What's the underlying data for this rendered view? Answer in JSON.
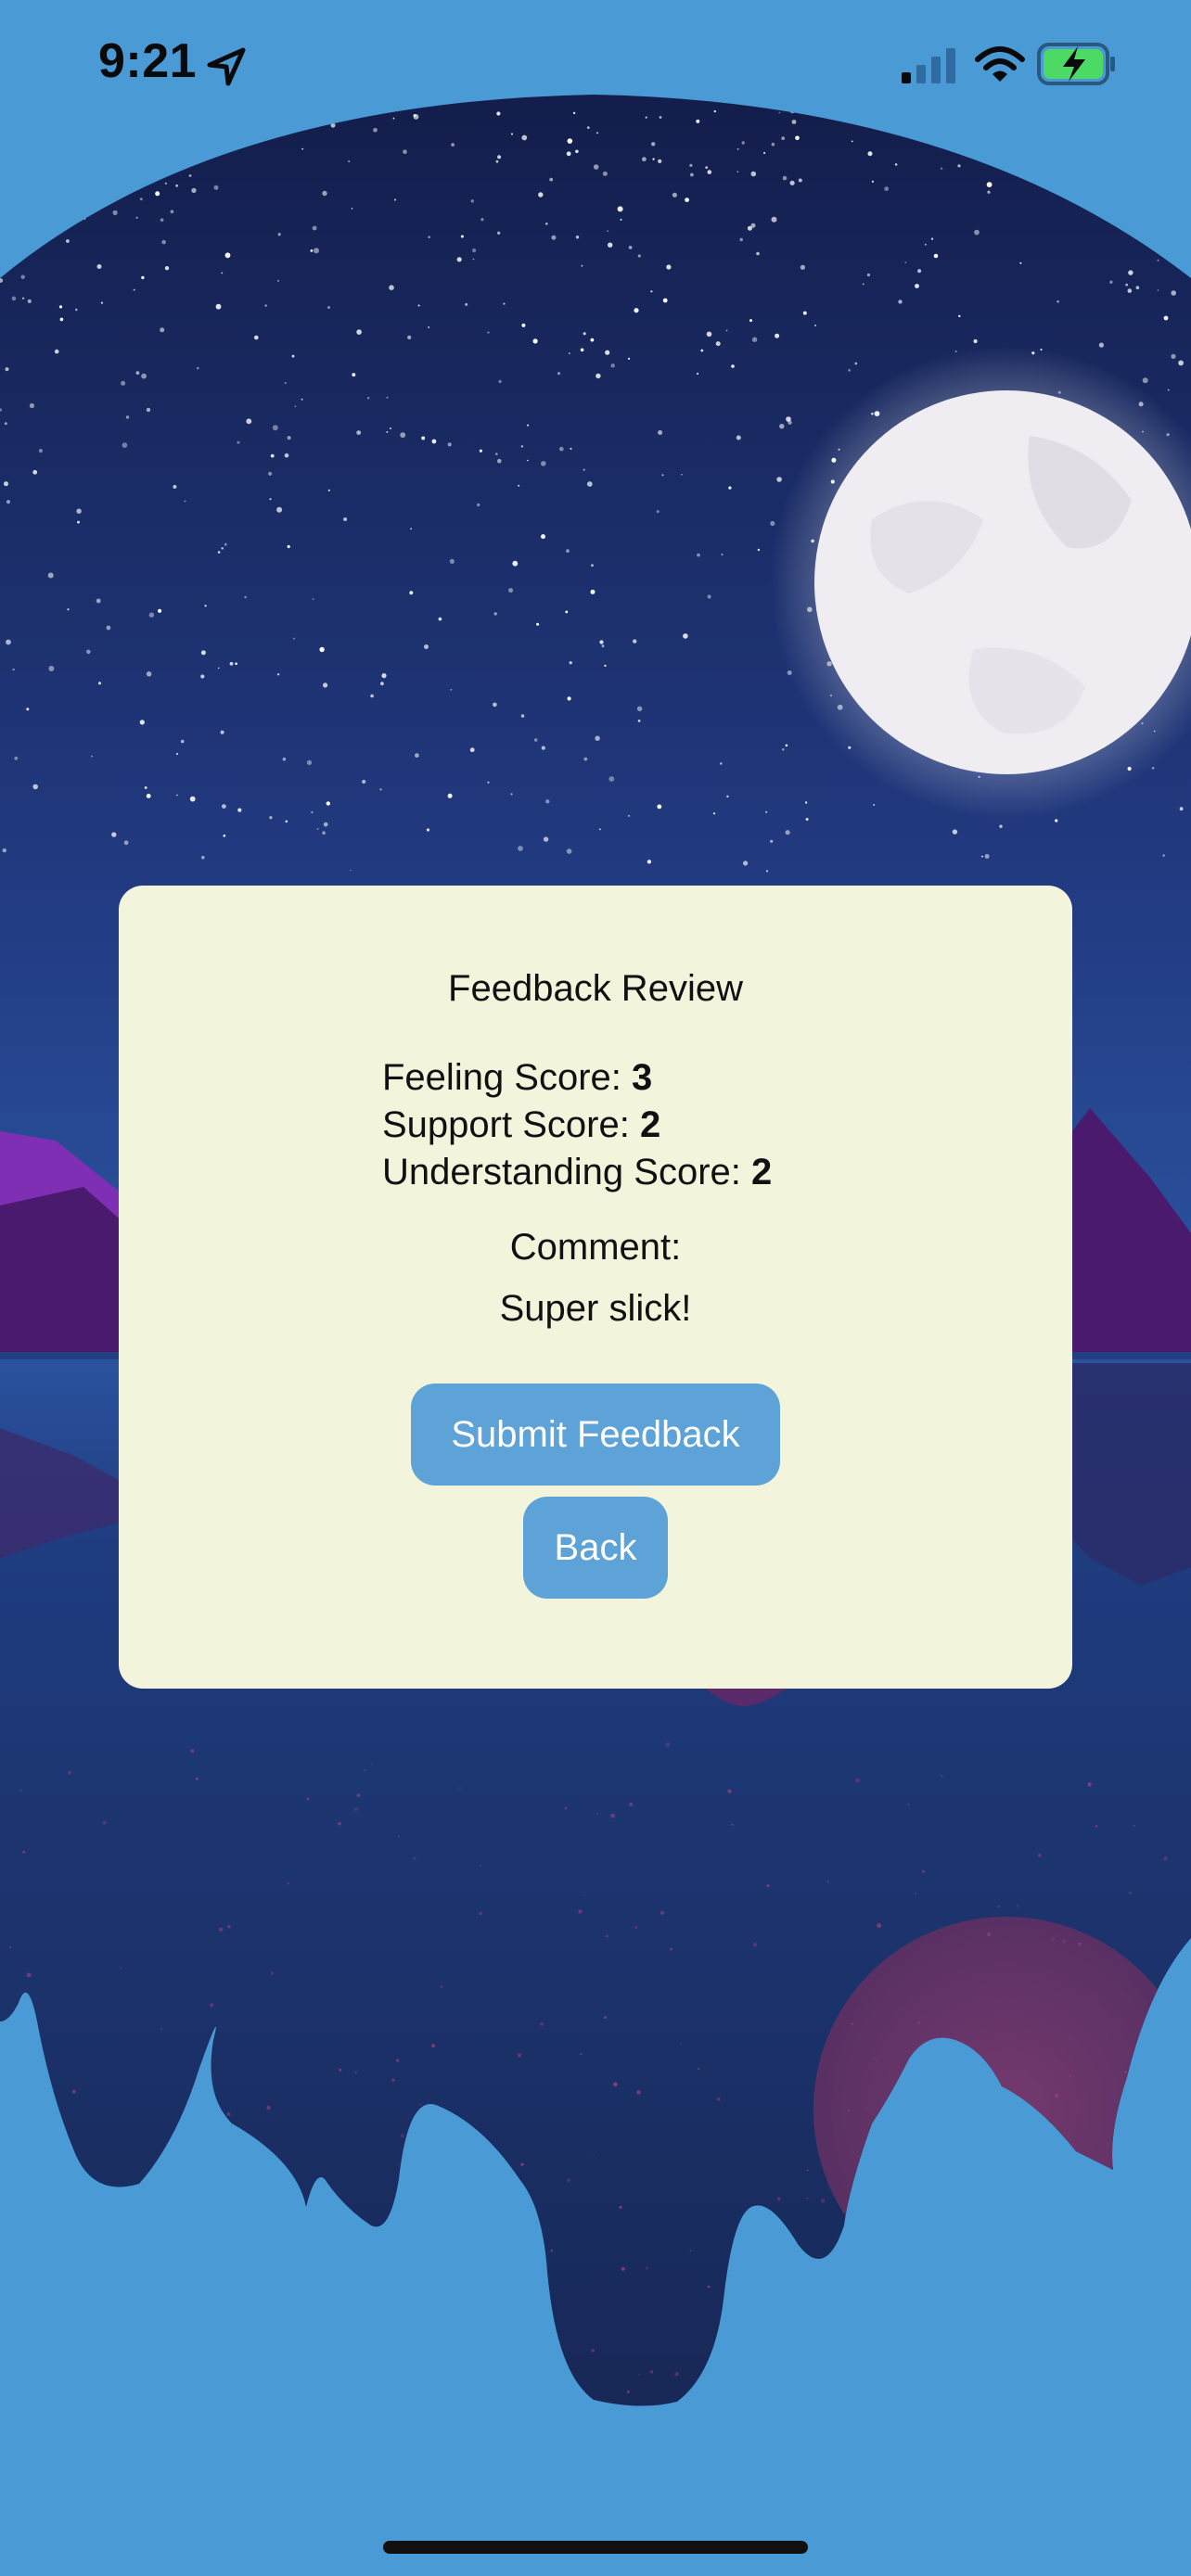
{
  "status_bar": {
    "time": "9:21"
  },
  "colors": {
    "outer_background": "#4a9ad6",
    "sky_top": "#111a45",
    "sky_bottom": "#2c55a2",
    "moon": "#f1eef4",
    "card": "#f3f4dc",
    "button": "#5ea3d8",
    "button_text": "#ffffff",
    "mountain_purple": "#7e2fb3"
  },
  "feedback_review": {
    "title": "Feedback Review",
    "scores": [
      {
        "label": "Feeling Score: ",
        "value": "3"
      },
      {
        "label": "Support Score: ",
        "value": "2"
      },
      {
        "label": "Understanding Score: ",
        "value": "2"
      }
    ],
    "comment_label": "Comment:",
    "comment_text": "Super slick!",
    "submit_label": "Submit Feedback",
    "back_label": "Back"
  }
}
